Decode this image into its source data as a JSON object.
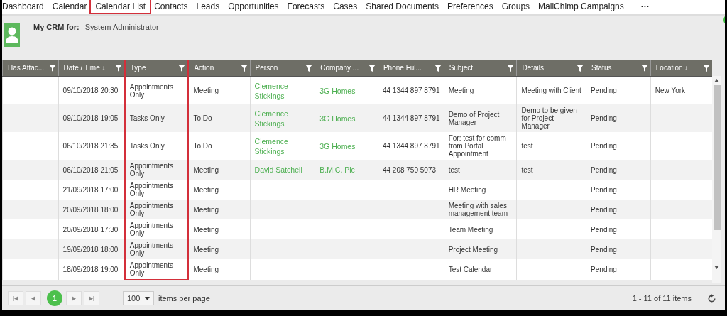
{
  "nav": {
    "tabs": [
      {
        "label": "Dashboard",
        "selected": false
      },
      {
        "label": "Calendar",
        "selected": false
      },
      {
        "label": "Calendar List",
        "selected": true
      },
      {
        "label": "Contacts",
        "selected": false
      },
      {
        "label": "Leads",
        "selected": false
      },
      {
        "label": "Opportunities",
        "selected": false
      },
      {
        "label": "Forecasts",
        "selected": false
      },
      {
        "label": "Cases",
        "selected": false
      },
      {
        "label": "Shared Documents",
        "selected": false
      },
      {
        "label": "Preferences",
        "selected": false
      },
      {
        "label": "Groups",
        "selected": false
      },
      {
        "label": "MailChimp Campaigns",
        "selected": false
      }
    ],
    "more": "···"
  },
  "header": {
    "label": "My CRM for:",
    "user": "System Administrator"
  },
  "table": {
    "columns": [
      "Has Attac...",
      "Date / Time ↓",
      "Type",
      "Action",
      "Person",
      "Company ...",
      "Phone Ful...",
      "Subject",
      "Details",
      "Status",
      "Location ↓"
    ],
    "rows": [
      [
        "",
        "09/10/2018 20:30",
        "Appointments Only",
        "Meeting",
        "Clemence Stickings",
        "3G Homes",
        "44 1344 897 8791",
        "Meeting",
        "Meeting with Client",
        "Pending",
        "New York"
      ],
      [
        "",
        "09/10/2018 19:05",
        "Tasks Only",
        "To Do",
        "Clemence Stickings",
        "3G Homes",
        "44 1344 897 8791",
        "Demo of Project Manager",
        "Demo to be given for Project Manager",
        "Pending",
        ""
      ],
      [
        "",
        "06/10/2018 21:35",
        "Tasks Only",
        "To Do",
        "Clemence Stickings",
        "3G Homes",
        "44 1344 897 8791",
        "For: test for comm from Portal Appointment",
        "test",
        "Pending",
        ""
      ],
      [
        "",
        "06/10/2018 21:05",
        "Appointments Only",
        "Meeting",
        "David Satchell",
        "B.M.C. Plc",
        "44 208 750 5073",
        "test",
        "test",
        "Pending",
        ""
      ],
      [
        "",
        "21/09/2018 17:00",
        "Appointments Only",
        "Meeting",
        "",
        "",
        "",
        "HR Meeting",
        "",
        "Pending",
        ""
      ],
      [
        "",
        "20/09/2018 18:00",
        "Appointments Only",
        "Meeting",
        "",
        "",
        "",
        "Meeting with sales management team",
        "",
        "Pending",
        ""
      ],
      [
        "",
        "20/09/2018 17:30",
        "Appointments Only",
        "Meeting",
        "",
        "",
        "",
        "Team Meeting",
        "",
        "Pending",
        ""
      ],
      [
        "",
        "19/09/2018 18:00",
        "Appointments Only",
        "Meeting",
        "",
        "",
        "",
        "Project Meeting",
        "",
        "Pending",
        ""
      ],
      [
        "",
        "18/09/2018 19:00",
        "Appointments Only",
        "Meeting",
        "",
        "",
        "",
        "Test Calendar",
        "",
        "Pending",
        ""
      ]
    ]
  },
  "pager": {
    "pages": [
      {
        "label": "1",
        "selected": true
      }
    ],
    "page_size": "100",
    "page_size_label": "items per page",
    "summary": "1 - 11 of 11 items"
  }
}
